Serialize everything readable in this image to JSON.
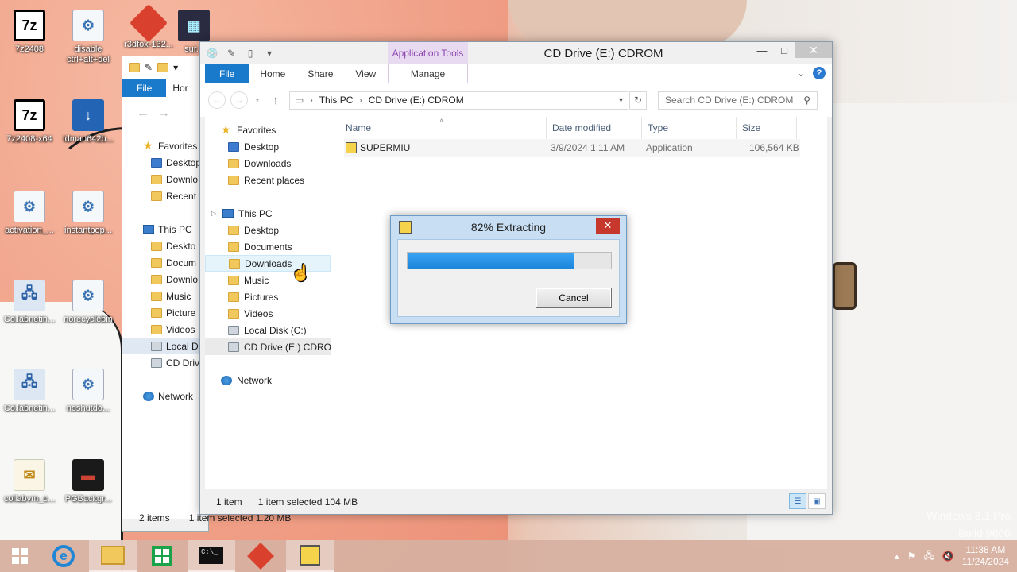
{
  "desktop": {
    "icons": [
      {
        "label": "7z2408",
        "icon": "7zip-icon"
      },
      {
        "label": "disable ctrl+alt+del",
        "icon": "script-icon"
      },
      {
        "label": "r3dfox-132...",
        "icon": "r3dfox-icon"
      },
      {
        "label": "sur...",
        "icon": "image-icon"
      },
      {
        "label": "7z2408-x64",
        "icon": "7zip-icon"
      },
      {
        "label": "idman642b...",
        "icon": "idm-icon"
      },
      {
        "label": "activation_...",
        "icon": "script-icon"
      },
      {
        "label": "instantpop...",
        "icon": "script-icon"
      },
      {
        "label": "Collabnetin...",
        "icon": "network-app-icon"
      },
      {
        "label": "norecyclebin",
        "icon": "script-icon"
      },
      {
        "label": "Collabnetin...",
        "icon": "network-app-icon"
      },
      {
        "label": "noshutdo...",
        "icon": "script-icon"
      },
      {
        "label": "collabvm_c...",
        "icon": "certificate-icon"
      },
      {
        "label": "PGBackgr...",
        "icon": "image-icon"
      }
    ],
    "watermark_line1": "Windows 8.1 Pro",
    "watermark_line2": "Build 9600"
  },
  "back_explorer": {
    "tab_file": "File",
    "tab_home": "Hor",
    "nav": [
      {
        "label": "Favorites",
        "top": true
      },
      {
        "label": "Desktop"
      },
      {
        "label": "Downlo"
      },
      {
        "label": "Recent"
      },
      {
        "label": "This PC",
        "top": true
      },
      {
        "label": "Deskto"
      },
      {
        "label": "Docum"
      },
      {
        "label": "Downlo"
      },
      {
        "label": "Music"
      },
      {
        "label": "Picture"
      },
      {
        "label": "Videos"
      },
      {
        "label": "Local D"
      },
      {
        "label": "CD Driv"
      },
      {
        "label": "Network",
        "top": true
      }
    ],
    "status_items": "2 items",
    "status_selected": "1 item selected  1.20 MB"
  },
  "explorer": {
    "title": "CD Drive (E:) CDROM",
    "app_tools": "Application Tools",
    "tabs": {
      "file": "File",
      "home": "Home",
      "share": "Share",
      "view": "View",
      "manage": "Manage"
    },
    "address": {
      "seg1": "This PC",
      "seg2": "CD Drive (E:) CDROM"
    },
    "search_placeholder": "Search CD Drive (E:) CDROM",
    "nav": {
      "favorites": "Favorites",
      "fav_desktop": "Desktop",
      "fav_downloads": "Downloads",
      "fav_recent": "Recent places",
      "this_pc": "This PC",
      "pc_desktop": "Desktop",
      "pc_documents": "Documents",
      "pc_downloads": "Downloads",
      "pc_music": "Music",
      "pc_pictures": "Pictures",
      "pc_videos": "Videos",
      "pc_local_disk": "Local Disk (C:)",
      "pc_cd_drive": "CD Drive (E:) CDROM",
      "network": "Network"
    },
    "columns": {
      "name": "Name",
      "date": "Date modified",
      "type": "Type",
      "size": "Size"
    },
    "files": [
      {
        "name": "SUPERMIU",
        "date": "3/9/2024 1:11 AM",
        "type": "Application",
        "size": "106,564 KB"
      }
    ],
    "status_items": "1 item",
    "status_selected": "1 item selected  104 MB"
  },
  "dialog": {
    "title": "82% Extracting",
    "progress_percent": 82,
    "cancel_label": "Cancel"
  },
  "taskbar": {
    "apps": [
      "internet-explorer",
      "file-explorer",
      "store",
      "command-prompt",
      "r3dfox",
      "setup"
    ],
    "time": "11:38 AM",
    "date": "11/24/2024"
  }
}
